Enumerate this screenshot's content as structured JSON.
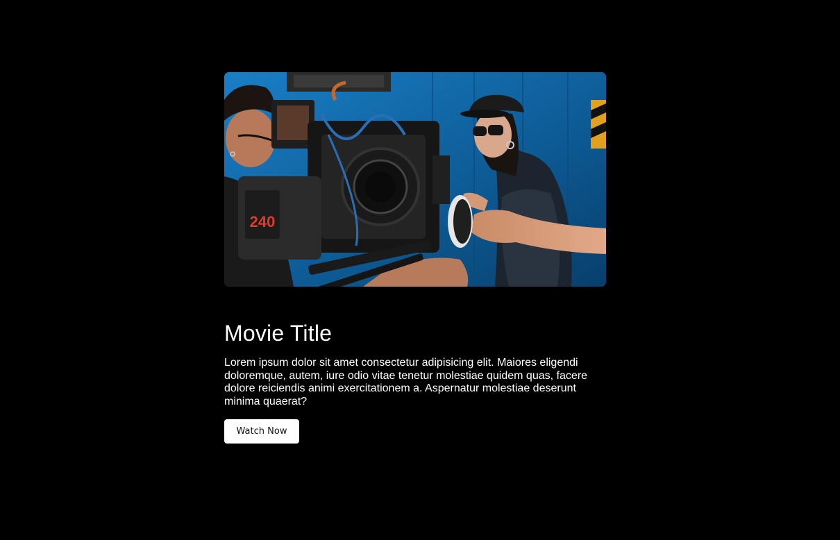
{
  "movie": {
    "title": "Movie Title",
    "description": "Lorem ipsum dolor sit amet consectetur adipisicing elit. Maiores eligendi doloremque, autem, iure odio vitae tenetur molestiae quidem quas, facere dolore reiciendis animi exercitationem a. Aspernatur molestiae deserunt minima quaerat?",
    "watch_button_label": "Watch Now",
    "camera_battery_label": "240"
  },
  "colors": {
    "page_background": "#000000",
    "text": "#ffffff",
    "button_background": "#ffffff",
    "button_text": "#111111",
    "scene_blue": "#0d5a94"
  }
}
